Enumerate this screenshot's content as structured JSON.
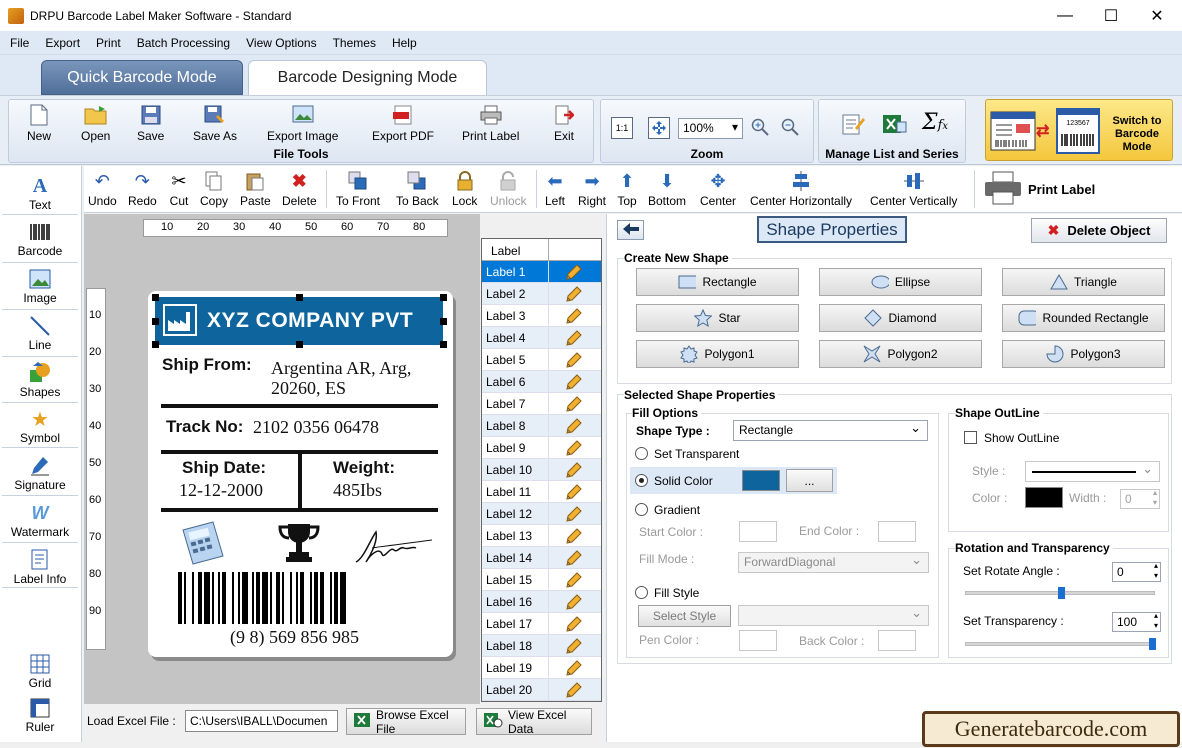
{
  "window": {
    "title": "DRPU Barcode Label Maker Software - Standard",
    "minimize_glyph": "—",
    "maximize_glyph": "☐",
    "close_glyph": "✕"
  },
  "menu": [
    "File",
    "Export",
    "Print",
    "Batch Processing",
    "View Options",
    "Themes",
    "Help"
  ],
  "modes": {
    "quick": "Quick Barcode Mode",
    "designing": "Barcode Designing Mode"
  },
  "ribbon": {
    "file_tools": {
      "label": "File Tools",
      "buttons": [
        "New",
        "Open",
        "Save",
        "Save As",
        "Export Image",
        "Export PDF",
        "Print Label",
        "Exit"
      ]
    },
    "zoom": {
      "label": "Zoom",
      "value": "100%"
    },
    "manage": {
      "label": "Manage List and Series"
    },
    "switch": {
      "label": "Switch to Barcode Mode",
      "preview_number": "123567"
    }
  },
  "toolbar": {
    "edit": [
      "Undo",
      "Redo",
      "Cut",
      "Copy",
      "Paste",
      "Delete"
    ],
    "arrange": [
      "To Front",
      "To Back",
      "Lock",
      "Unlock"
    ],
    "align": [
      "Left",
      "Right",
      "Top",
      "Bottom",
      "Center",
      "Center Horizontally",
      "Center Vertically"
    ],
    "print_label": "Print Label"
  },
  "sidebar": [
    "Text",
    "Barcode",
    "Image",
    "Line",
    "Shapes",
    "Symbol",
    "Signature",
    "Watermark",
    "Label Info",
    "Grid",
    "Ruler"
  ],
  "ruler": {
    "h": [
      "10",
      "20",
      "30",
      "40",
      "50",
      "60",
      "70",
      "80"
    ],
    "v": [
      "10",
      "20",
      "30",
      "40",
      "50",
      "60",
      "70",
      "80",
      "90"
    ]
  },
  "label": {
    "company": "XYZ COMPANY PVT",
    "ship_from_label": "Ship From:",
    "ship_from_line1": "Argentina AR, Arg,",
    "ship_from_line2": "20260, ES",
    "track_label": "Track No:",
    "track_value": "2102  0356  06478",
    "ship_date_label": "Ship Date:",
    "ship_date_value": "12-12-2000",
    "weight_label": "Weight:",
    "weight_value": "485Ibs",
    "barcode_number": "(9 8)  569 856 985"
  },
  "label_list": {
    "header": "Label",
    "items": [
      "Label 1",
      "Label 2",
      "Label 3",
      "Label 4",
      "Label 5",
      "Label 6",
      "Label 7",
      "Label 8",
      "Label 9",
      "Label 10",
      "Label 11",
      "Label 12",
      "Label 13",
      "Label 14",
      "Label 15",
      "Label 16",
      "Label 17",
      "Label 18",
      "Label 19",
      "Label 20"
    ],
    "selected": 0
  },
  "shape_panel": {
    "title": "Shape Properties",
    "delete": "Delete Object",
    "create_title": "Create New Shape",
    "shapes": [
      "Rectangle",
      "Ellipse",
      "Triangle",
      "Star",
      "Diamond",
      "Rounded Rectangle",
      "Polygon1",
      "Polygon2",
      "Polygon3"
    ],
    "selected_title": "Selected Shape Properties",
    "fill": {
      "title": "Fill Options",
      "shape_type_label": "Shape Type :",
      "shape_type": "Rectangle",
      "set_transparent": "Set Transparent",
      "solid_color": "Solid Color",
      "solid_color_value": "#0e659e",
      "more": "...",
      "gradient": "Gradient",
      "start_color": "Start Color :",
      "end_color": "End Color :",
      "fill_mode_label": "Fill Mode :",
      "fill_mode": "ForwardDiagonal",
      "fill_style": "Fill Style",
      "select_style": "Select Style",
      "pen_color": "Pen Color :",
      "back_color": "Back Color :"
    },
    "outline": {
      "title": "Shape OutLine",
      "show": "Show OutLine",
      "style_label": "Style :",
      "color_label": "Color :",
      "width_label": "Width :",
      "width_value": "0"
    },
    "rotation": {
      "title": "Rotation and Transparency",
      "rotate_label": "Set Rotate Angle :",
      "rotate_value": "0",
      "transparency_label": "Set Transparency :",
      "transparency_value": "100"
    }
  },
  "bottom": {
    "excel_label": "Load Excel File :",
    "excel_path": "C:\\Users\\IBALL\\Documen",
    "browse": "Browse Excel File",
    "view": "View Excel Data"
  },
  "watermark": "Generatebarcode.com"
}
